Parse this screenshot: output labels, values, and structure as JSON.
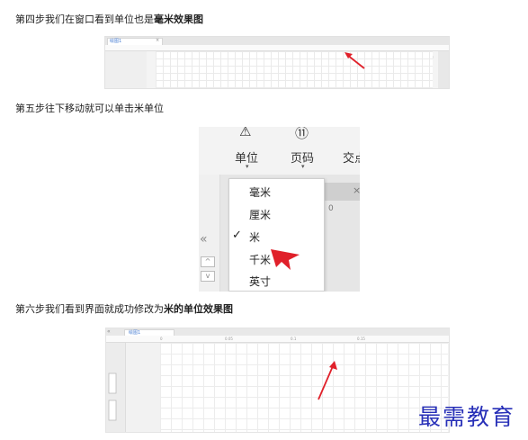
{
  "steps": {
    "step4": {
      "normal": "第四步我们在窗口看到单位也是",
      "bold": "毫米效果图"
    },
    "step5": {
      "normal": "第五步往下移动就可以单击米单位"
    },
    "step6": {
      "normal": "第六步我们看到界面就成功修改为",
      "bold": "米的单位效果图"
    }
  },
  "shot1": {
    "tab_label": "绘图1",
    "tab_close": "×"
  },
  "shot2": {
    "ribbon": [
      {
        "icon": "⚠",
        "label": "单位",
        "caret": "▾"
      },
      {
        "icon": "⑪",
        "label": "页码",
        "caret": "▾"
      },
      {
        "icon": "",
        "label": "交点",
        "caret": ""
      }
    ],
    "left_chevron": "«",
    "left_up": "^",
    "left_down": "v",
    "left_close": "×",
    "right_close": "×",
    "ruler_number": "0",
    "menu": [
      {
        "label": "毫米",
        "checked": ""
      },
      {
        "label": "厘米",
        "checked": ""
      },
      {
        "label": "米",
        "checked": "✓"
      },
      {
        "label": "千米",
        "checked": ""
      },
      {
        "label": "英寸",
        "checked": ""
      }
    ]
  },
  "shot3": {
    "tab_label": "绘图1",
    "corner": "«",
    "ruler_ticks": [
      "0",
      "0.05",
      "0.1",
      "0.15"
    ]
  },
  "watermark": "最需教育",
  "colors": {
    "arrow_red": "#e0202a",
    "watermark_blue": "#2830b8",
    "tab_blue": "#4a7fd3"
  }
}
